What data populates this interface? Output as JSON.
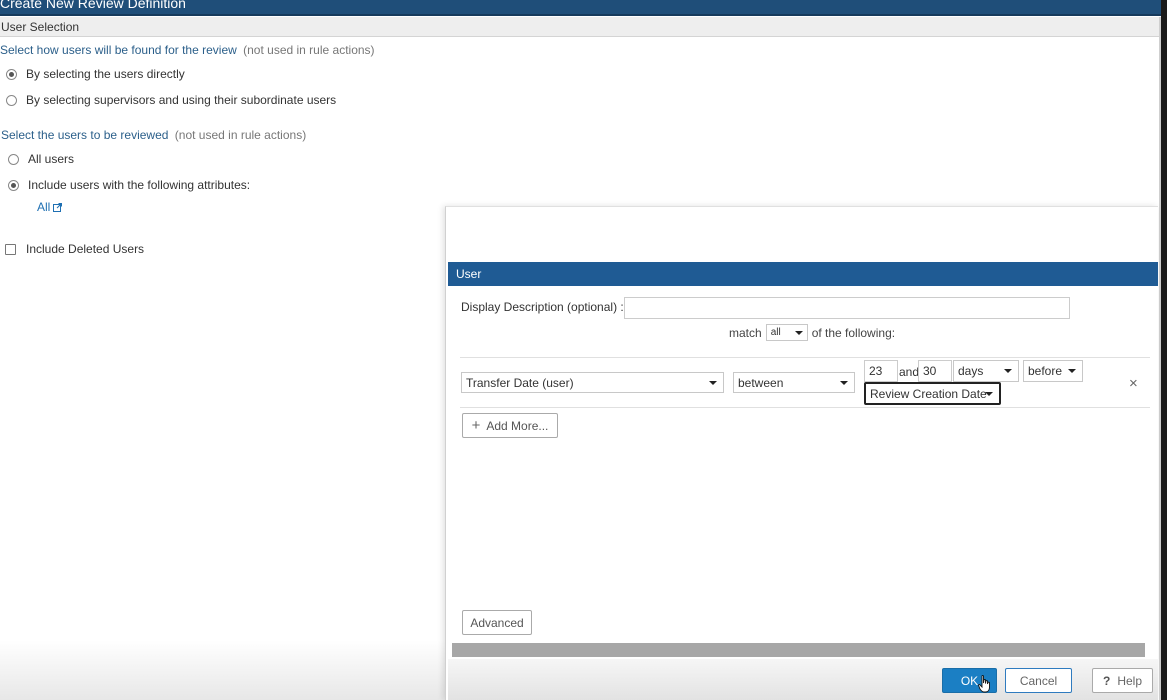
{
  "window": {
    "title": "Create New Review Definition"
  },
  "section": {
    "title": "User Selection"
  },
  "find_users": {
    "prompt": "Select how users will be found for the review",
    "note": "(not used in rule actions)",
    "options": [
      {
        "label": "By selecting the users directly",
        "selected": true
      },
      {
        "label": "By selecting supervisors and using their subordinate users",
        "selected": false
      }
    ]
  },
  "users_reviewed": {
    "prompt": "Select the users to be reviewed",
    "note": "(not used in rule actions)",
    "options": [
      {
        "label": "All users",
        "selected": false
      },
      {
        "label": "Include users with the following attributes:",
        "selected": true
      }
    ],
    "attribute_link": "All"
  },
  "include_deleted": {
    "label": "Include Deleted Users",
    "checked": false
  },
  "dialog": {
    "header": "User",
    "display_description_label": "Display Description (optional) :",
    "display_description_value": "",
    "match_prefix": "match",
    "match_value": "all",
    "match_suffix": "of the following:",
    "rule": {
      "attribute": "Transfer Date (user)",
      "operator": "between",
      "value_from": "23",
      "and_label": "and",
      "value_to": "30",
      "unit": "days",
      "direction": "before",
      "reference": "Review Creation Date",
      "remove_symbol": "×"
    },
    "add_more_label": "Add More...",
    "advanced_label": "Advanced",
    "ok_label": "OK",
    "cancel_label": "Cancel",
    "help_label": "Help",
    "help_symbol": "?"
  }
}
